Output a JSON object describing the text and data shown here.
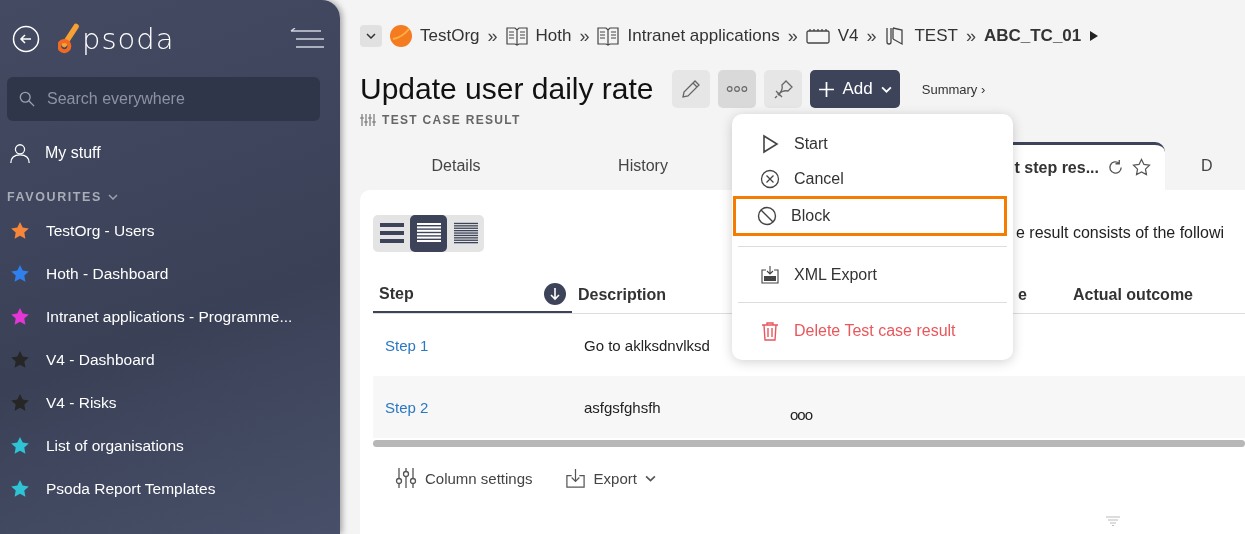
{
  "sidebar": {
    "logo": "psoda",
    "search": {
      "placeholder": "Search everywhere"
    },
    "my_stuff": "My stuff",
    "favourites_heading": "FAVOURITES",
    "favourites": [
      {
        "label": "TestOrg - Users",
        "color": "#f5863a"
      },
      {
        "label": "Hoth - Dashboard",
        "color": "#2f80ed"
      },
      {
        "label": "Intranet applications - Programme...",
        "color": "#e535d6"
      },
      {
        "label": "V4 - Dashboard",
        "color": "#262626"
      },
      {
        "label": "V4 - Risks",
        "color": "#262626"
      },
      {
        "label": "List of organisations",
        "color": "#2ec4d6"
      },
      {
        "label": "Psoda Report Templates",
        "color": "#2ec4d6"
      }
    ]
  },
  "breadcrumb": [
    {
      "label": "TestOrg",
      "kind": "org"
    },
    {
      "separator": "»",
      "label": "Hoth",
      "kind": "book"
    },
    {
      "separator": "»",
      "label": "Intranet applications",
      "kind": "book"
    },
    {
      "separator": "»",
      "label": "V4",
      "kind": "board"
    },
    {
      "separator": "»",
      "label": "TEST",
      "kind": "test"
    },
    {
      "separator": "»",
      "label": "ABC_TC_01",
      "kind": "current"
    }
  ],
  "page": {
    "title": "Update user daily rate",
    "subtitle": "TEST CASE RESULT",
    "add_button": "Add",
    "summary_link": "Summary ›"
  },
  "tabs": [
    {
      "label": "Details",
      "selected": false
    },
    {
      "label": "History",
      "selected": false
    },
    {
      "label": "t step res...",
      "selected": true
    },
    {
      "label": "D",
      "selected": false
    }
  ],
  "views": [
    {
      "kind": "large",
      "selected": false
    },
    {
      "kind": "medium",
      "selected": true
    },
    {
      "kind": "compact",
      "selected": false
    }
  ],
  "intro": "e result consists of the followi",
  "table": {
    "columns": [
      {
        "label": "Step",
        "sorted": true
      },
      {
        "label": "Description",
        "sorted": false
      },
      {
        "label": "e",
        "sorted": false
      },
      {
        "label": "Actual outcome",
        "sorted": false
      }
    ],
    "rows": [
      {
        "step": "Step 1",
        "description": "Go to aklksdnvlksd",
        "column_3": ""
      },
      {
        "step": "Step 2",
        "description": "asfgsfghsfh",
        "column_3": "ooo"
      }
    ]
  },
  "toolbar": {
    "column_settings": "Column settings",
    "export": "Export"
  },
  "menu": [
    {
      "label": "Start",
      "kind": "start",
      "selected": false
    },
    {
      "label": "Cancel",
      "kind": "cancel",
      "selected": false
    },
    {
      "label": "Block",
      "kind": "block",
      "selected": true
    },
    {
      "label": "XML Export",
      "kind": "xml",
      "selected": false
    },
    {
      "label": "Delete Test case result",
      "kind": "delete",
      "selected": false
    }
  ]
}
